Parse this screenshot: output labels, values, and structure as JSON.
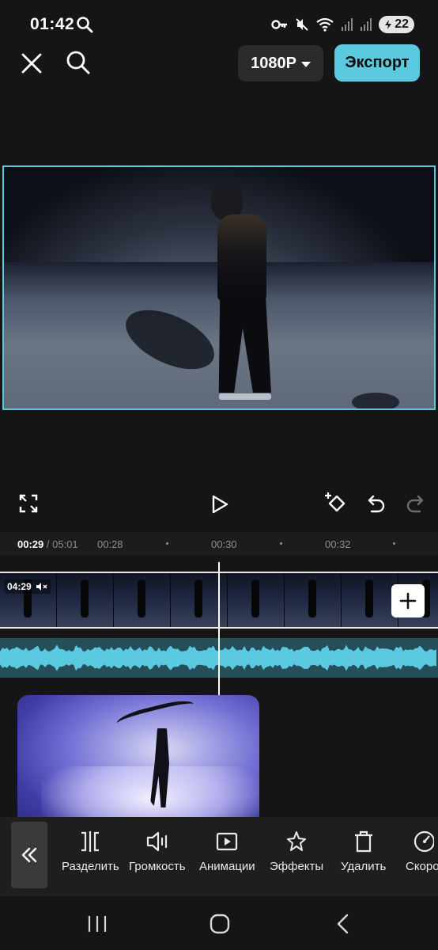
{
  "status_bar": {
    "time": "01:42",
    "battery": "22",
    "icons": [
      "search-icon",
      "key-icon",
      "mute-icon",
      "wifi-icon",
      "signal-icon",
      "signal-icon",
      "battery-icon"
    ]
  },
  "toolbar": {
    "resolution": "1080P",
    "export_label": "Экспорт",
    "icons": [
      "close-icon",
      "search-icon"
    ]
  },
  "player": {
    "icons": [
      "fullscreen-icon",
      "play-icon",
      "keyframe-icon",
      "undo-icon",
      "redo-icon"
    ]
  },
  "timeline": {
    "current_time": "00:29",
    "separator": "/",
    "duration": "05:01",
    "ruler_ticks": [
      "00:28",
      "00:30",
      "00:32"
    ],
    "clip_duration": "04:29",
    "clip_muted_icon": "mute-icon",
    "add_clip_icon": "plus-icon"
  },
  "tools": [
    {
      "label": "Разделить",
      "icon": "split-icon"
    },
    {
      "label": "Громкость",
      "icon": "volume-icon"
    },
    {
      "label": "Анимации",
      "icon": "animation-icon"
    },
    {
      "label": "Эффекты",
      "icon": "effects-icon"
    },
    {
      "label": "Удалить",
      "icon": "delete-icon"
    },
    {
      "label": "Скоро",
      "icon": "speed-icon"
    }
  ],
  "colors": {
    "accent": "#5bc9df",
    "background": "#151515",
    "toolbar_bg": "#1e1e1e"
  }
}
